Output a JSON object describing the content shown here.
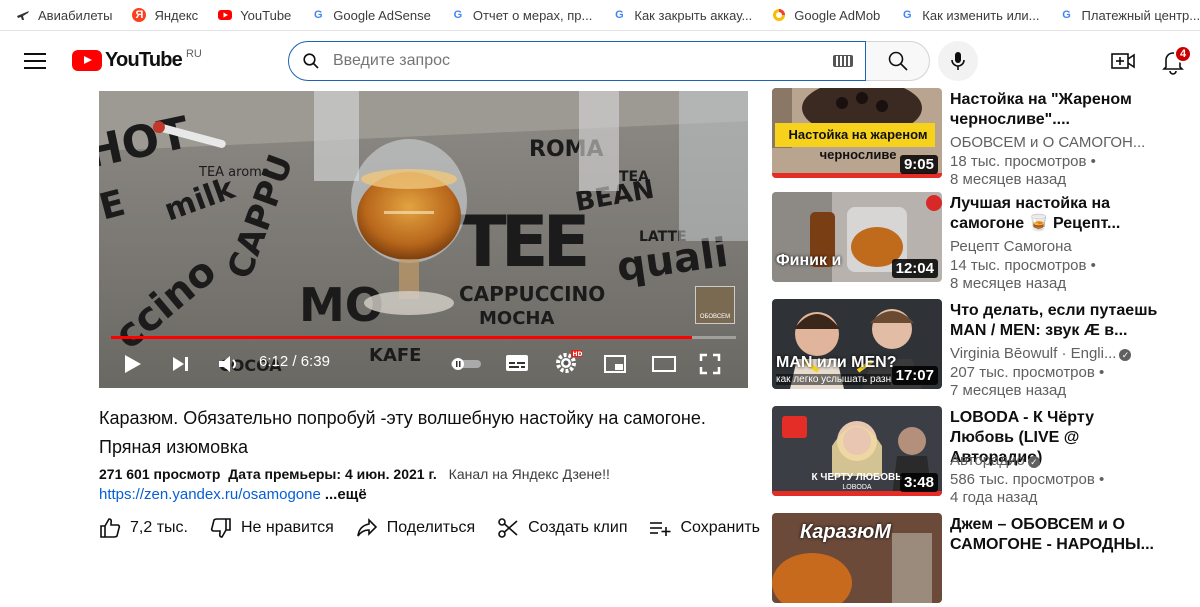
{
  "bookmarks": [
    {
      "label": "Авиабилеты",
      "icon": "plane-icon"
    },
    {
      "label": "Яндекс",
      "icon": "yandex-icon"
    },
    {
      "label": "YouTube",
      "icon": "youtube-icon"
    },
    {
      "label": "Google AdSense",
      "icon": "google-icon"
    },
    {
      "label": "Отчет о мерах, пр...",
      "icon": "google-icon"
    },
    {
      "label": "Как закрыть аккау...",
      "icon": "google-icon"
    },
    {
      "label": "Google AdMob",
      "icon": "admob-icon"
    },
    {
      "label": "Как изменить или...",
      "icon": "google-icon"
    },
    {
      "label": "Платежный центр...",
      "icon": "google-icon"
    }
  ],
  "masthead": {
    "logo_text": "YouTube",
    "country_code": "RU",
    "search_placeholder": "Введите запрос",
    "notification_count": "4"
  },
  "player": {
    "current_time": "6:12",
    "duration": "6:39",
    "time_separator": " / ",
    "progress": 0.93,
    "watermark_text": "ОБОВСЕМ"
  },
  "video": {
    "title": "Каразюм. Обязательно попробуй -эту волшебную настойку на самогоне. Пряная изюмовка",
    "views": "271 601 просмотр",
    "premiere": "Дата премьеры: 4 июн. 2021 г.",
    "description_start": "Канал на Яндекс Дзене!!",
    "link": "https://zen.yandex.ru/osamogone",
    "more_label": "...ещё"
  },
  "actions": {
    "like": "7,2 тыс.",
    "dislike": "Не нравится",
    "share": "Поделиться",
    "clip": "Создать клип",
    "save": "Сохранить"
  },
  "recommendations": [
    {
      "title": "Настойка на \"Жареном черносливе\"....",
      "channel": "ОБОВСЕМ и О САМОГОН...",
      "views": "18 тыс. просмотров •",
      "age": "8 месяцев назад",
      "duration": "9:05",
      "thumb_text": "Настойка на жареном черносливе",
      "verified": false
    },
    {
      "title": "Лучшая настойка на самогоне 🥃 Рецепт...",
      "channel": "Рецепт Самогона",
      "views": "14 тыс. просмотров •",
      "age": "8 месяцев назад",
      "duration": "12:04",
      "thumb_text": "Финик и",
      "verified": false
    },
    {
      "title": "Что делать, если путаешь MAN / MEN: звук Æ в...",
      "channel": "Virginia Bēowulf · Engli...",
      "views": "207 тыс. просмотров •",
      "age": "7 месяцев назад",
      "duration": "17:07",
      "thumb_text": "MAN или MEN?",
      "thumb_sub": "как легко услышать разн",
      "verified": true
    },
    {
      "title": "LOBODA - К Чёрту Любовь (LIVE @ Авторадио)",
      "channel": "Авторадио",
      "views": "586 тыс. просмотров •",
      "age": "4 года назад",
      "duration": "3:48",
      "thumb_text": "К ЧЕРТУ ЛЮБОВЬ",
      "thumb_sub": "LOBODA",
      "verified": true
    },
    {
      "title": "Джем – ОБОВСЕМ и О САМОГОНЕ - НАРОДНЫ...",
      "channel": "",
      "views": "",
      "age": "",
      "duration": "",
      "thumb_text": "КаразюМ",
      "verified": false
    }
  ]
}
